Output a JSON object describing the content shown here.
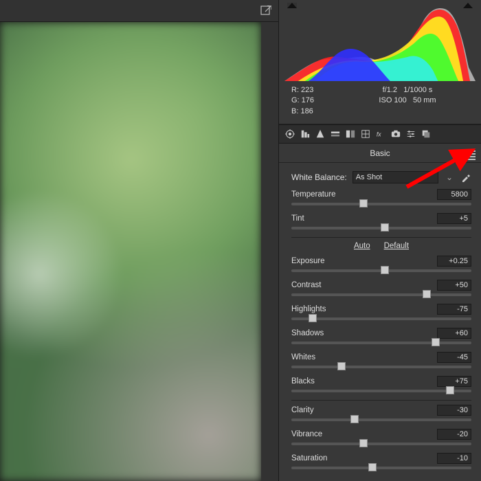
{
  "export_icon": "export",
  "histogram": {
    "clip_left": true,
    "clip_right": true,
    "rgb": {
      "r": "R:  223",
      "g": "G:  176",
      "b": "B:  186"
    },
    "exif": {
      "line1a": "f/1.2",
      "line1b": "1/1000 s",
      "line2a": "ISO 100",
      "line2b": "50 mm"
    }
  },
  "iconbar": [
    "aperture",
    "histogram",
    "sharpen",
    "grayscale",
    "splittone",
    "lens",
    "fx",
    "camera",
    "sliders",
    "presets"
  ],
  "panel": {
    "title": "Basic",
    "wb_label": "White Balance:",
    "wb_value": "As Shot",
    "auto": "Auto",
    "default": "Default"
  },
  "sliders": {
    "temperature": {
      "label": "Temperature",
      "value": "5800",
      "pos": 40,
      "grad": "grad-temp"
    },
    "tint": {
      "label": "Tint",
      "value": "+5",
      "pos": 52,
      "grad": "grad-tint"
    },
    "exposure": {
      "label": "Exposure",
      "value": "+0.25",
      "pos": 52
    },
    "contrast": {
      "label": "Contrast",
      "value": "+50",
      "pos": 75
    },
    "highlights": {
      "label": "Highlights",
      "value": "-75",
      "pos": 12
    },
    "shadows": {
      "label": "Shadows",
      "value": "+60",
      "pos": 80
    },
    "whites": {
      "label": "Whites",
      "value": "-45",
      "pos": 28
    },
    "blacks": {
      "label": "Blacks",
      "value": "+75",
      "pos": 88
    },
    "clarity": {
      "label": "Clarity",
      "value": "-30",
      "pos": 35
    },
    "vibrance": {
      "label": "Vibrance",
      "value": "-20",
      "pos": 40,
      "grad": "grad-hue"
    },
    "saturation": {
      "label": "Saturation",
      "value": "-10",
      "pos": 45,
      "grad": "grad-hue"
    }
  },
  "annotation": "red-arrow"
}
